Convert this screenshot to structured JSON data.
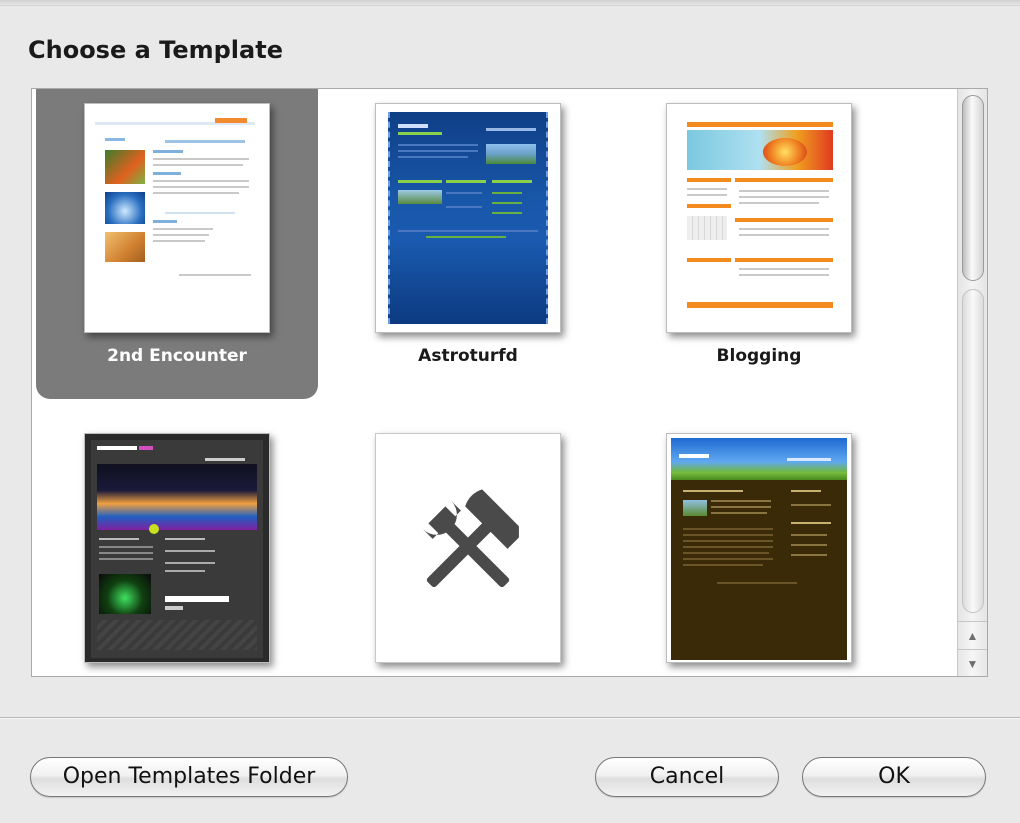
{
  "dialog": {
    "title": "Choose a Template"
  },
  "templates": [
    {
      "name": "2nd Encounter",
      "selected": true,
      "row": 0,
      "col": 0
    },
    {
      "name": "Astroturfd",
      "selected": false,
      "row": 0,
      "col": 1
    },
    {
      "name": "Blogging",
      "selected": false,
      "row": 0,
      "col": 2
    },
    {
      "name": "",
      "selected": false,
      "row": 1,
      "col": 0
    },
    {
      "name": "",
      "selected": false,
      "row": 1,
      "col": 1
    },
    {
      "name": "",
      "selected": false,
      "row": 1,
      "col": 2
    }
  ],
  "buttons": {
    "open_folder": "Open Templates Folder",
    "cancel": "Cancel",
    "ok": "OK"
  },
  "icons": {
    "custom_template": "hammer-wrench-icon",
    "scroll_up": "up-arrow-icon",
    "scroll_down": "down-arrow-icon"
  },
  "colors": {
    "selection": "#7b7b7b",
    "dialog_bg": "#e9e9e9"
  }
}
